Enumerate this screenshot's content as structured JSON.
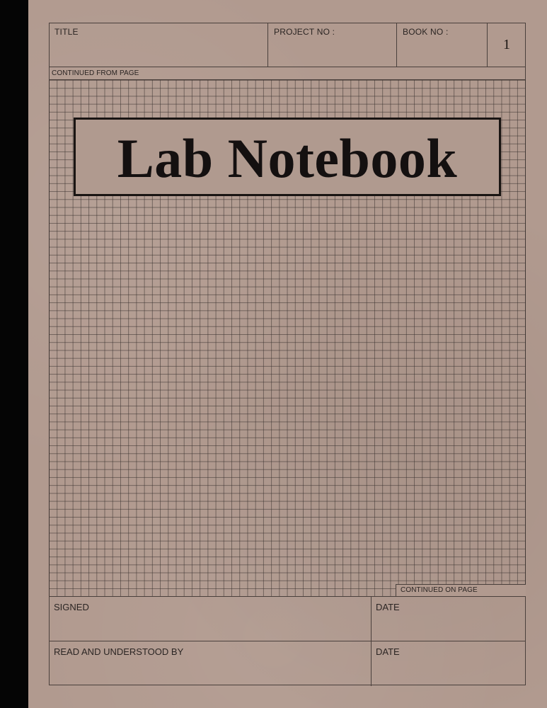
{
  "header": {
    "title_label": "TITLE",
    "project_label": "PROJECT NO :",
    "book_label": "BOOK NO :",
    "book_number": "1"
  },
  "grid": {
    "continued_from_label": "CONTINUED FROM PAGE",
    "continued_on_label": "CONTINUED ON PAGE"
  },
  "cover_title": "Lab Notebook",
  "footer": {
    "signed_label": "SIGNED",
    "date_label_1": "DATE",
    "read_label": "READ AND UNDERSTOOD BY",
    "date_label_2": "DATE"
  },
  "colors": {
    "cover": "#b19a8f",
    "spine": "#050505",
    "lines": "#4a403c",
    "title_text": "#141010"
  }
}
